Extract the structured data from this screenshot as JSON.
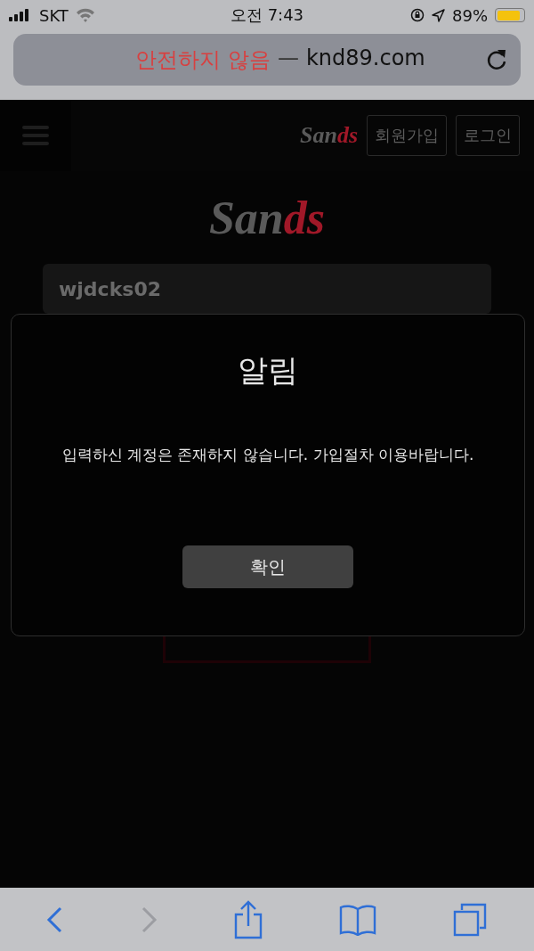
{
  "status_bar": {
    "carrier": "SKT",
    "time": "오전 7:43",
    "battery": "89%"
  },
  "address_bar": {
    "warning": "안전하지 않음",
    "separator": "—",
    "domain": "knd89.com"
  },
  "header": {
    "logo": {
      "main": "San",
      "accent": "ds"
    },
    "buttons": [
      "회원가입",
      "로그인"
    ]
  },
  "logo": {
    "main": "San",
    "accent": "ds"
  },
  "login_form": {
    "username": "wjdcks02"
  },
  "dialog": {
    "title": "알림",
    "message": "입력하신 계정은 존재하지 않습니다. 가입절차 이용바랍니다.",
    "button": "확인"
  },
  "toolbar": [
    {
      "kind": "back",
      "disabled": false
    },
    {
      "kind": "forward",
      "disabled": true
    },
    {
      "kind": "share",
      "disabled": false
    },
    {
      "kind": "bookmarks",
      "disabled": false
    },
    {
      "kind": "tabs",
      "disabled": false
    }
  ]
}
